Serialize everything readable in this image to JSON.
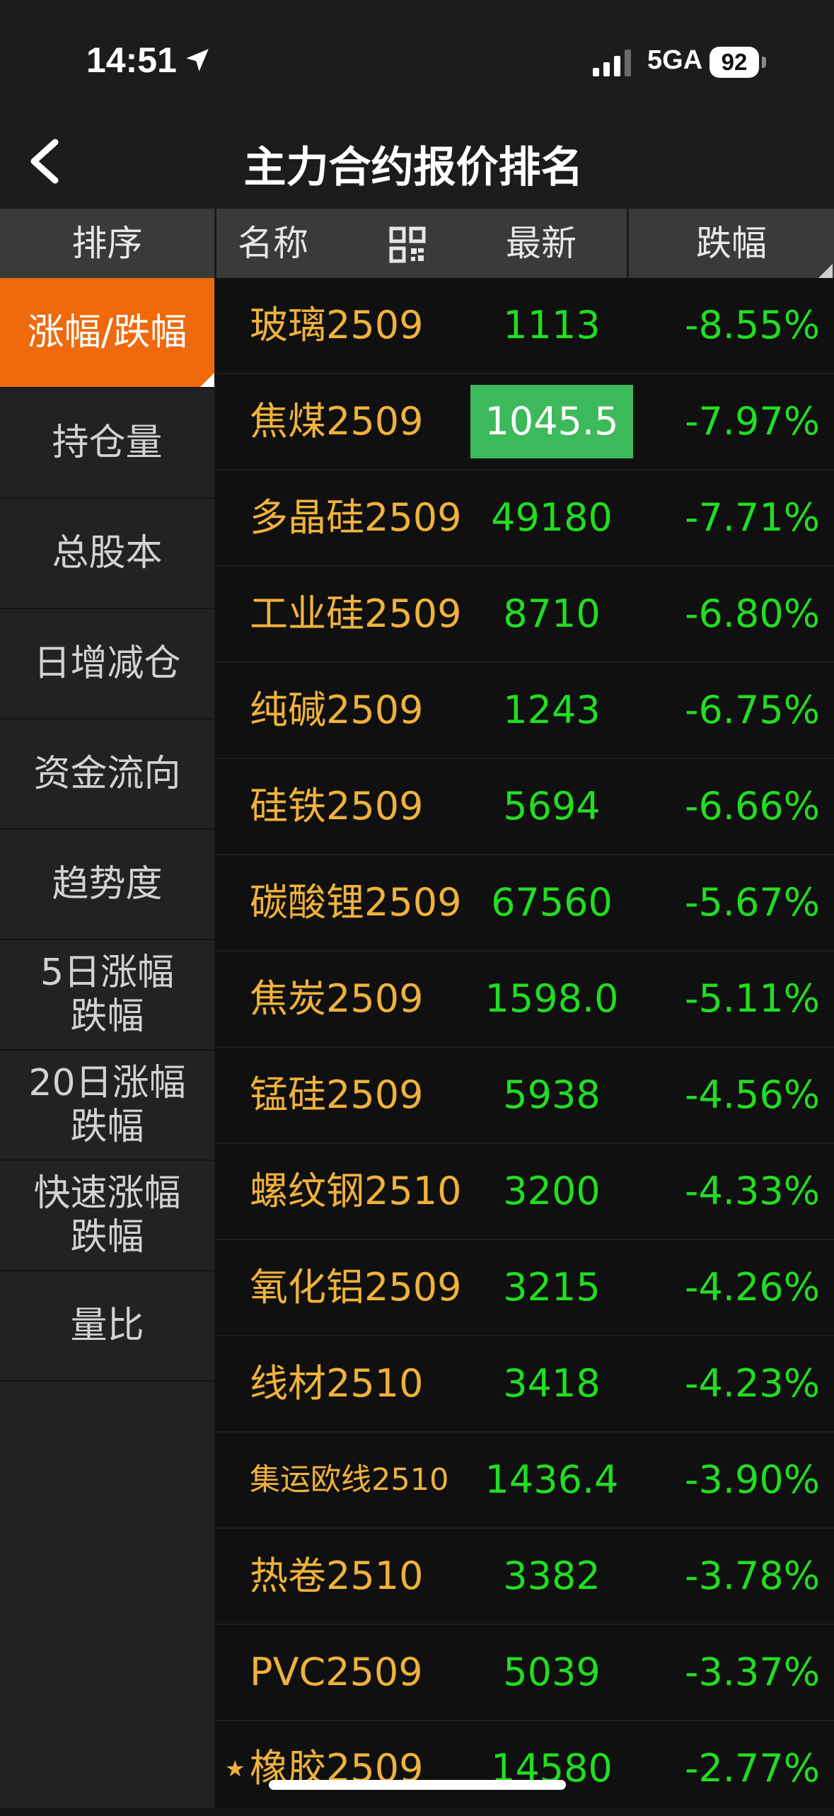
{
  "status_bar": {
    "time": "14:51",
    "network": "5GA",
    "battery": "92"
  },
  "nav": {
    "title": "主力合约报价排名"
  },
  "header": {
    "sort": "排序",
    "name": "名称",
    "latest": "最新",
    "change": "跌幅"
  },
  "sidebar": {
    "items": [
      {
        "label": "涨幅/跌幅"
      },
      {
        "label": "持仓量"
      },
      {
        "label": "总股本"
      },
      {
        "label": "日增减仓"
      },
      {
        "label": "资金流向"
      },
      {
        "label": "趋势度"
      },
      {
        "label": "5日涨幅\n跌幅"
      },
      {
        "label": "20日涨幅\n跌幅"
      },
      {
        "label": "快速涨幅\n跌幅"
      },
      {
        "label": "量比"
      }
    ]
  },
  "rows": [
    {
      "name": "玻璃2509",
      "latest": "1113",
      "change": "-8.55%"
    },
    {
      "name": "焦煤2509",
      "latest": "1045.5",
      "change": "-7.97%"
    },
    {
      "name": "多晶硅2509",
      "latest": "49180",
      "change": "-7.71%"
    },
    {
      "name": "工业硅2509",
      "latest": "8710",
      "change": "-6.80%"
    },
    {
      "name": "纯碱2509",
      "latest": "1243",
      "change": "-6.75%"
    },
    {
      "name": "硅铁2509",
      "latest": "5694",
      "change": "-6.66%"
    },
    {
      "name": "碳酸锂2509",
      "latest": "67560",
      "change": "-5.67%"
    },
    {
      "name": "焦炭2509",
      "latest": "1598.0",
      "change": "-5.11%"
    },
    {
      "name": "锰硅2509",
      "latest": "5938",
      "change": "-4.56%"
    },
    {
      "name": "螺纹钢2510",
      "latest": "3200",
      "change": "-4.33%"
    },
    {
      "name": "氧化铝2509",
      "latest": "3215",
      "change": "-4.26%"
    },
    {
      "name": "线材2510",
      "latest": "3418",
      "change": "-4.23%"
    },
    {
      "name": "集运欧线2510",
      "latest": "1436.4",
      "change": "-3.90%"
    },
    {
      "name": "热卷2510",
      "latest": "3382",
      "change": "-3.78%"
    },
    {
      "name": "PVC2509",
      "latest": "5039",
      "change": "-3.37%"
    },
    {
      "name": "橡胶2509",
      "latest": "14580",
      "change": "-2.77%"
    }
  ],
  "colors": {
    "accent_orange": "#ee6a0c",
    "name_gold": "#f0b23c",
    "down_green": "#22dd22",
    "highlight_green": "#3cb95a"
  },
  "icons": {
    "back": "chevron-left-icon",
    "qr": "qr-code-icon",
    "location": "location-arrow-icon",
    "signal": "signal-bars-icon",
    "favorite": "star-icon"
  }
}
